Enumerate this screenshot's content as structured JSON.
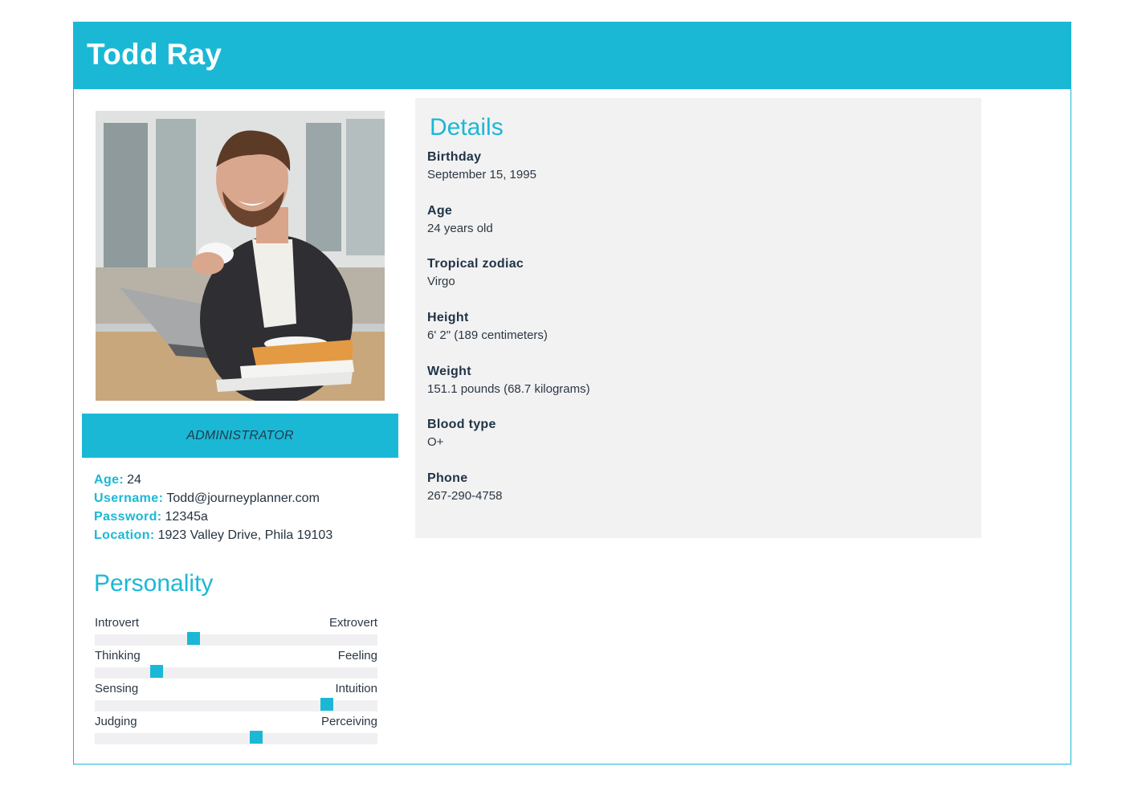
{
  "header": {
    "name": "Todd Ray"
  },
  "profile": {
    "role": "ADMINISTRATOR",
    "info": [
      {
        "key": "Age:",
        "value": "24"
      },
      {
        "key": "Username:",
        "value": "Todd@journeyplanner.com"
      },
      {
        "key": "Password:",
        "value": "12345a"
      },
      {
        "key": "Location:",
        "value": "1923 Valley Drive, Phila 19103"
      }
    ]
  },
  "personality": {
    "title": "Personality",
    "traits": [
      {
        "left": "Introvert",
        "right": "Extrovert",
        "level": 0.35
      },
      {
        "left": "Thinking",
        "right": "Feeling",
        "level": 0.22
      },
      {
        "left": "Sensing",
        "right": "Intuition",
        "level": 0.82
      },
      {
        "left": "Judging",
        "right": "Perceiving",
        "level": 0.57
      }
    ]
  },
  "details": {
    "title": "Details",
    "items": [
      {
        "label": "Birthday",
        "value": "September 15, 1995"
      },
      {
        "label": "Age",
        "value": "24 years old"
      },
      {
        "label": "Tropical zodiac",
        "value": "Virgo"
      },
      {
        "label": "Height",
        "value": "6' 2\" (189 centimeters)"
      },
      {
        "label": "Weight",
        "value": "151.1 pounds (68.7 kilograms)"
      },
      {
        "label": "Blood type",
        "value": "O+"
      },
      {
        "label": "Phone",
        "value": "267-290-4758"
      }
    ]
  },
  "colors": {
    "accent": "#1bb8d5",
    "panel": "#f2f2f2",
    "track": "#f0f0f2"
  }
}
